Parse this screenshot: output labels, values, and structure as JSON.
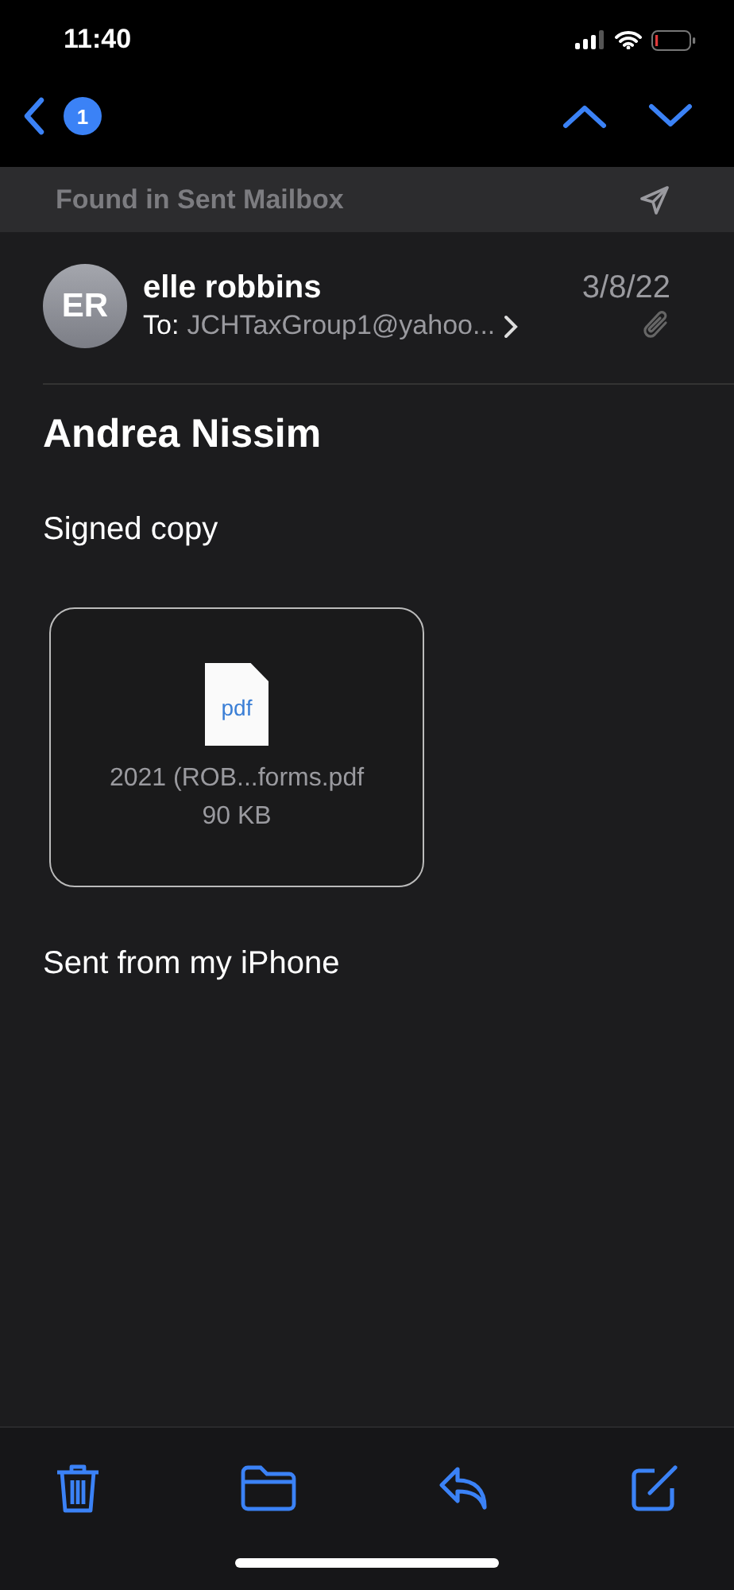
{
  "status_bar": {
    "time": "11:40"
  },
  "nav": {
    "unread_count": "1"
  },
  "banner": {
    "text": "Found in Sent Mailbox"
  },
  "message": {
    "avatar_initials": "ER",
    "sender": "elle robbins",
    "date": "3/8/22",
    "to_label": "To:",
    "recipient": "JCHTaxGroup1@yahoo...",
    "has_attachment": true,
    "subject": "Andrea Nissim",
    "body": "Signed copy",
    "attachment": {
      "type_label": "pdf",
      "filename": "2021 (ROB...forms.pdf",
      "size": "90 KB"
    },
    "signature": "Sent from my iPhone"
  }
}
